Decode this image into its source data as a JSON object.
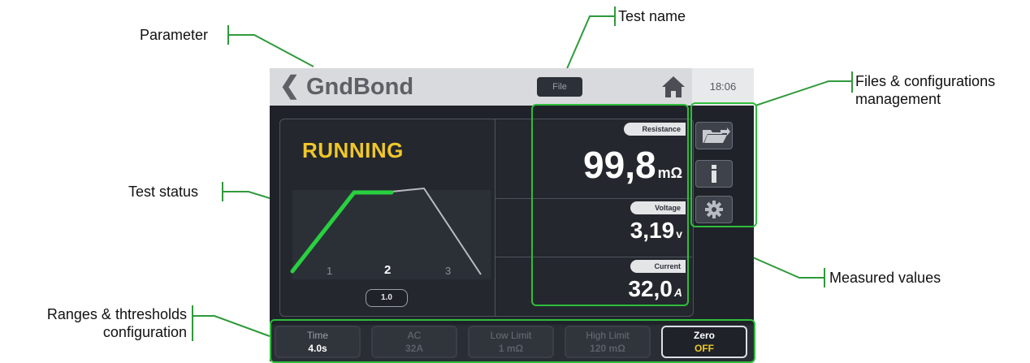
{
  "annotations": {
    "parameter": "Parameter",
    "test_name": "Test name",
    "files_config_line1": "Files & configurations",
    "files_config_line2": "management",
    "test_status": "Test status",
    "measured_values": "Measured values",
    "ranges_line1": "Ranges & thtresholds",
    "ranges_line2": "configuration"
  },
  "screen": {
    "title": "GndBond",
    "file_button": "File",
    "clock": "18:06",
    "status": "RUNNING",
    "phases": [
      "1",
      "2",
      "3"
    ],
    "step_value": "1.0",
    "measurements": [
      {
        "label": "Resistance",
        "value": "99,8",
        "unit": "mΩ"
      },
      {
        "label": "Voltage",
        "value": "3,19",
        "unit": "v"
      },
      {
        "label": "Current",
        "value": "32,0",
        "unit": "A"
      }
    ],
    "footer": [
      {
        "label": "Time",
        "value": "4.0s",
        "enabled": true
      },
      {
        "label": "AC",
        "value": "32A",
        "enabled": false
      },
      {
        "label": "Low Limit",
        "value": "1 mΩ",
        "enabled": false
      },
      {
        "label": "High Limit",
        "value": "120 mΩ",
        "enabled": false
      },
      {
        "label": "Zero",
        "value": "OFF",
        "enabled": true
      }
    ]
  },
  "icons": [
    "back-chevron-icon",
    "home-icon",
    "folder-open-icon",
    "info-icon",
    "gear-icon"
  ],
  "colors": {
    "highlight": "#2ebd3c",
    "status": "#f0c72a",
    "zero_off": "#f0c72a",
    "callout": "#2e9a3a"
  }
}
